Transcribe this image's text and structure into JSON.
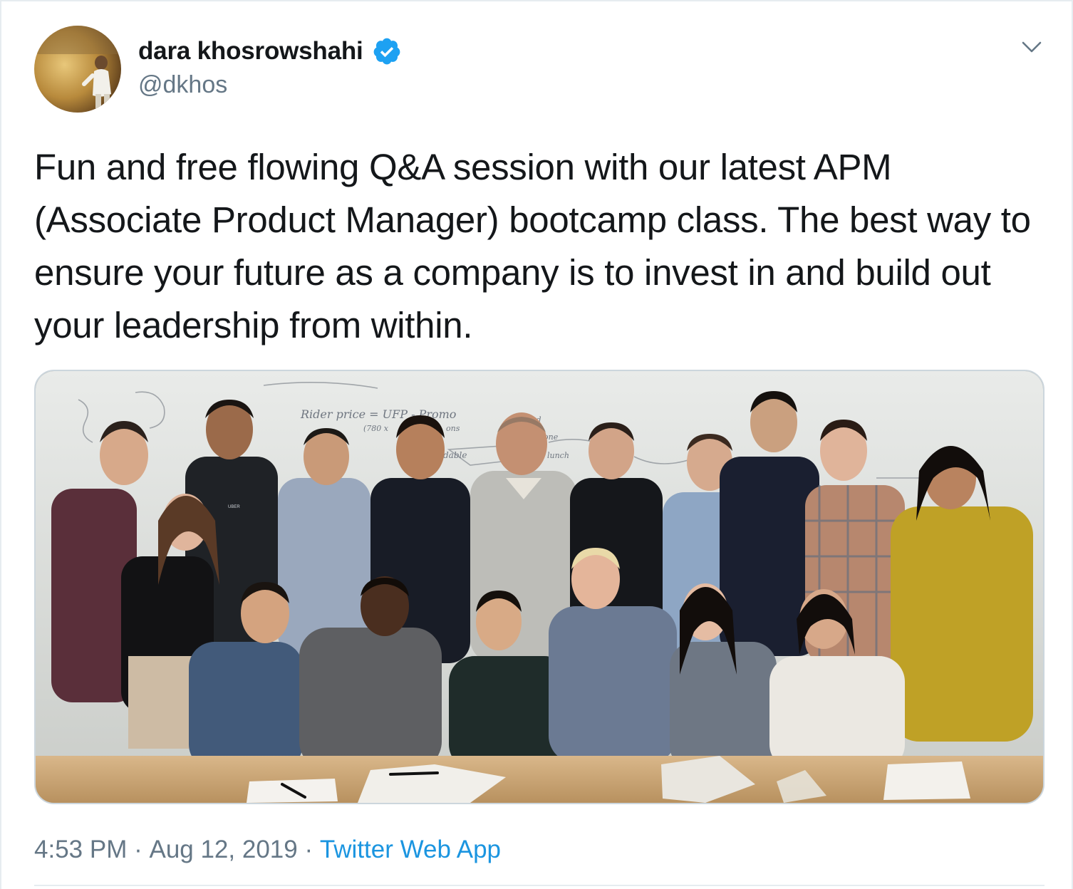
{
  "tweet": {
    "author": {
      "display_name": "dara khosrowshahi",
      "handle": "@dkhos",
      "verified": true,
      "avatar_icon": "avatar-photo"
    },
    "menu_icon": "chevron-down-icon",
    "text": "Fun and free flowing Q&A session with our latest APM (Associate Product Manager) bootcamp class.  The best way to ensure your future as a company is to invest in and build out your leadership from within.",
    "media": {
      "type": "photo",
      "shirt_label": "UBER",
      "whiteboard_notes": [
        "Rider price = UFP - Promo",
        "(780 x",
        "ons",
        "dable",
        "ed",
        "bone",
        "lunch"
      ]
    },
    "time": "4:53 PM",
    "separator": " · ",
    "date": "Aug 12, 2019",
    "source": "Twitter Web App"
  },
  "colors": {
    "text_primary": "#14171a",
    "text_secondary": "#657786",
    "link": "#1b95e0",
    "verified_badge": "#1da1f2",
    "border": "#e6ecf0"
  }
}
